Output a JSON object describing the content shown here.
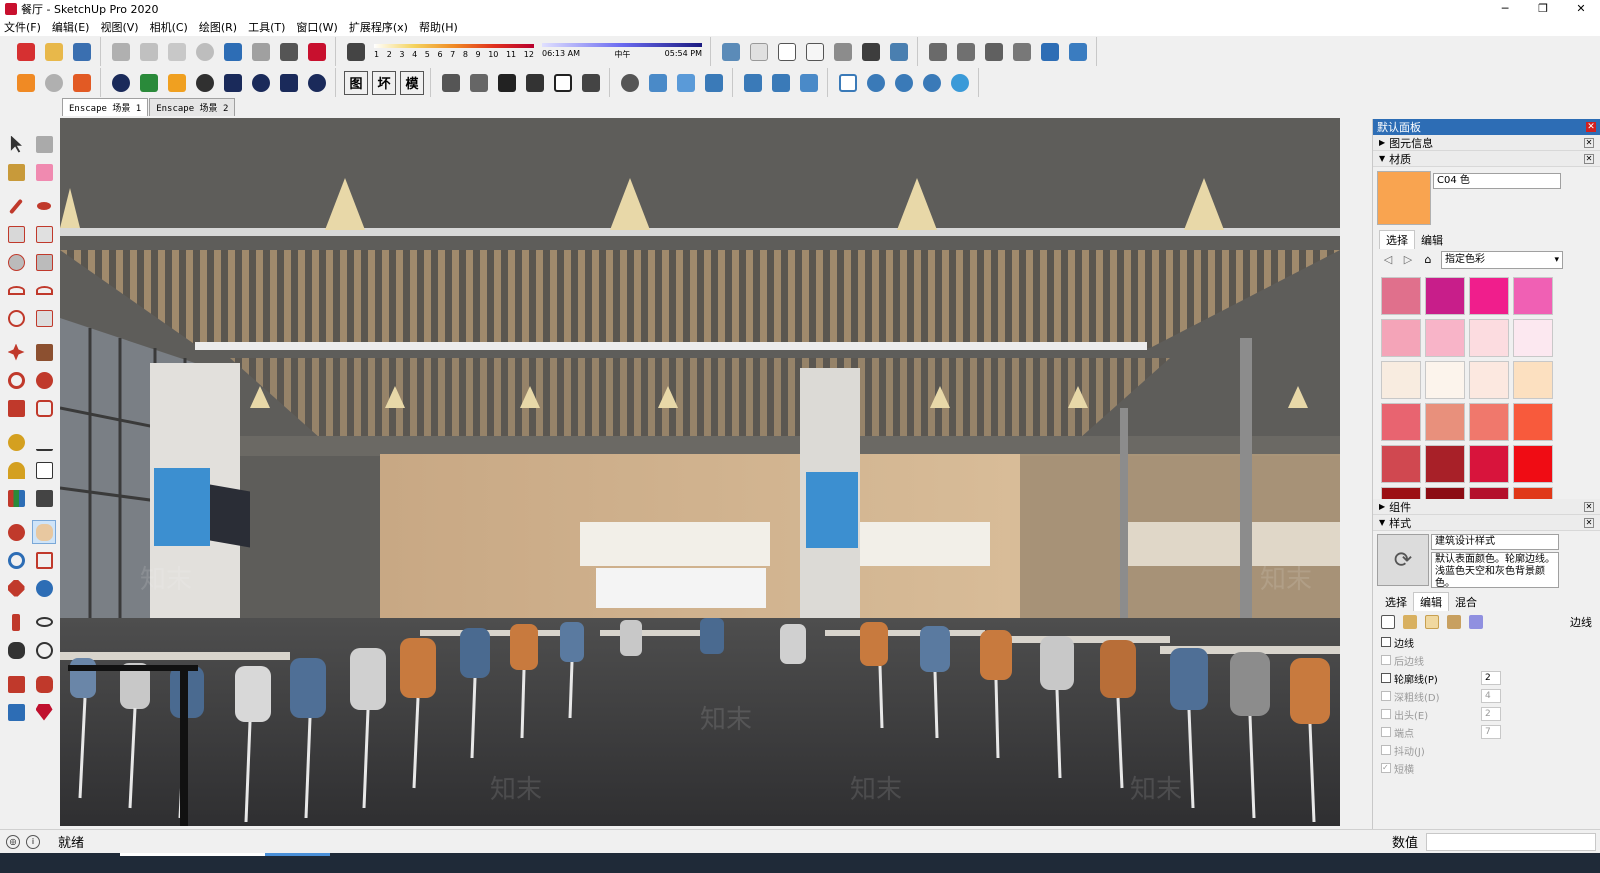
{
  "window": {
    "title": "餐厅 - SketchUp Pro 2020",
    "min": "─",
    "max": "❐",
    "close": "✕"
  },
  "menu": [
    "文件(F)",
    "编辑(E)",
    "视图(V)",
    "相机(C)",
    "绘图(R)",
    "工具(T)",
    "窗口(W)",
    "扩展程序(x)",
    "帮助(H)"
  ],
  "toolbar": {
    "shadow_numbers": [
      "1",
      "2",
      "3",
      "4",
      "5",
      "6",
      "7",
      "8",
      "9",
      "10",
      "11",
      "12"
    ],
    "time_start": "06:13 AM",
    "time_mid": "中午",
    "time_end": "05:54 PM",
    "text_buttons": [
      "图",
      "坏",
      "模"
    ]
  },
  "scenes": [
    "Enscape 场景 1",
    "Enscape 场景 2"
  ],
  "status": {
    "text": "就绪",
    "value_label": "数值"
  },
  "panel": {
    "title": "默认面板",
    "entity_info": "图元信息",
    "materials": "材质",
    "material_name": "C04 色",
    "material_color": "#f9a450",
    "tabs": [
      "选择",
      "编辑"
    ],
    "collection": "指定色彩",
    "swatches": [
      "#e0708c",
      "#c81e8a",
      "#f01e8c",
      "#f060b4",
      "#f4a4b8",
      "#f8b4c8",
      "#fcdce0",
      "#fce8f0",
      "#f8ece0",
      "#fcf4ec",
      "#fce8e0",
      "#fce0c0",
      "#e86470",
      "#e8907c",
      "#f0786c",
      "#f85a3c",
      "#d04850",
      "#a82028",
      "#d8143c",
      "#f00c14",
      "#9c1014",
      "#8c0c14",
      "#b4102c",
      "#e03818"
    ],
    "components": "组件",
    "styles": "样式",
    "style_name": "建筑设计样式",
    "style_desc": "默认表面颜色。轮廓边线。浅蓝色天空和灰色背景颜色。",
    "style_tabs": [
      "选择",
      "编辑",
      "混合"
    ],
    "edge_label": "边线",
    "options": [
      {
        "label": "边线",
        "enabled": true,
        "checked": false,
        "value": ""
      },
      {
        "label": "后边线",
        "enabled": false,
        "checked": false,
        "value": ""
      },
      {
        "label": "轮廓线(P)",
        "enabled": true,
        "checked": false,
        "value": "2"
      },
      {
        "label": "深粗线(D)",
        "enabled": false,
        "checked": false,
        "value": "4"
      },
      {
        "label": "出头(E)",
        "enabled": false,
        "checked": false,
        "value": "2"
      },
      {
        "label": "端点",
        "enabled": false,
        "checked": false,
        "value": "7"
      },
      {
        "label": "抖动(J)",
        "enabled": false,
        "checked": false,
        "value": ""
      },
      {
        "label": "短横",
        "enabled": false,
        "checked": true,
        "value": ""
      }
    ]
  },
  "viewport_watermark": [
    "知末",
    "知末",
    "知末",
    "知末",
    "知末",
    "知末"
  ]
}
